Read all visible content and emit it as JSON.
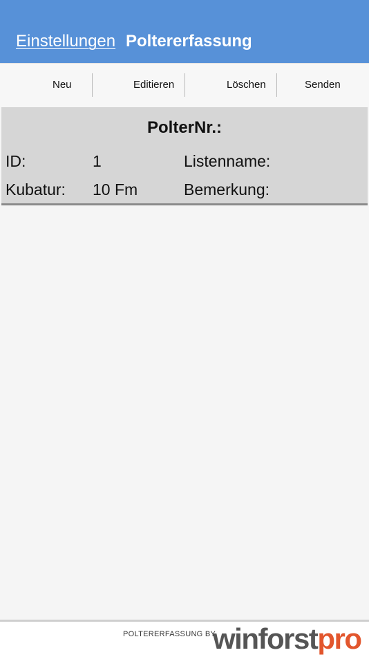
{
  "header": {
    "back_label": "Einstellungen",
    "title": "Poltererfassung"
  },
  "toolbar": {
    "new_label": "Neu",
    "edit_label": "Editieren",
    "delete_label": "Löschen",
    "send_label": "Senden"
  },
  "record": {
    "title": "PolterNr.:",
    "id_label": "ID:",
    "id_value": "1",
    "listname_label": "Listenname:",
    "volume_label": "Kubatur:",
    "volume_value": "10 Fm",
    "remark_label": "Bemerkung:"
  },
  "footer": {
    "by_text": "POLTERERFASSUNG BY",
    "logo_part1": "winforst",
    "logo_part2": "pro"
  },
  "colors": {
    "header_bg": "#5791d8",
    "card_bg": "#d6d6d6",
    "logo_accent": "#e2562d",
    "logo_dark": "#555555"
  }
}
